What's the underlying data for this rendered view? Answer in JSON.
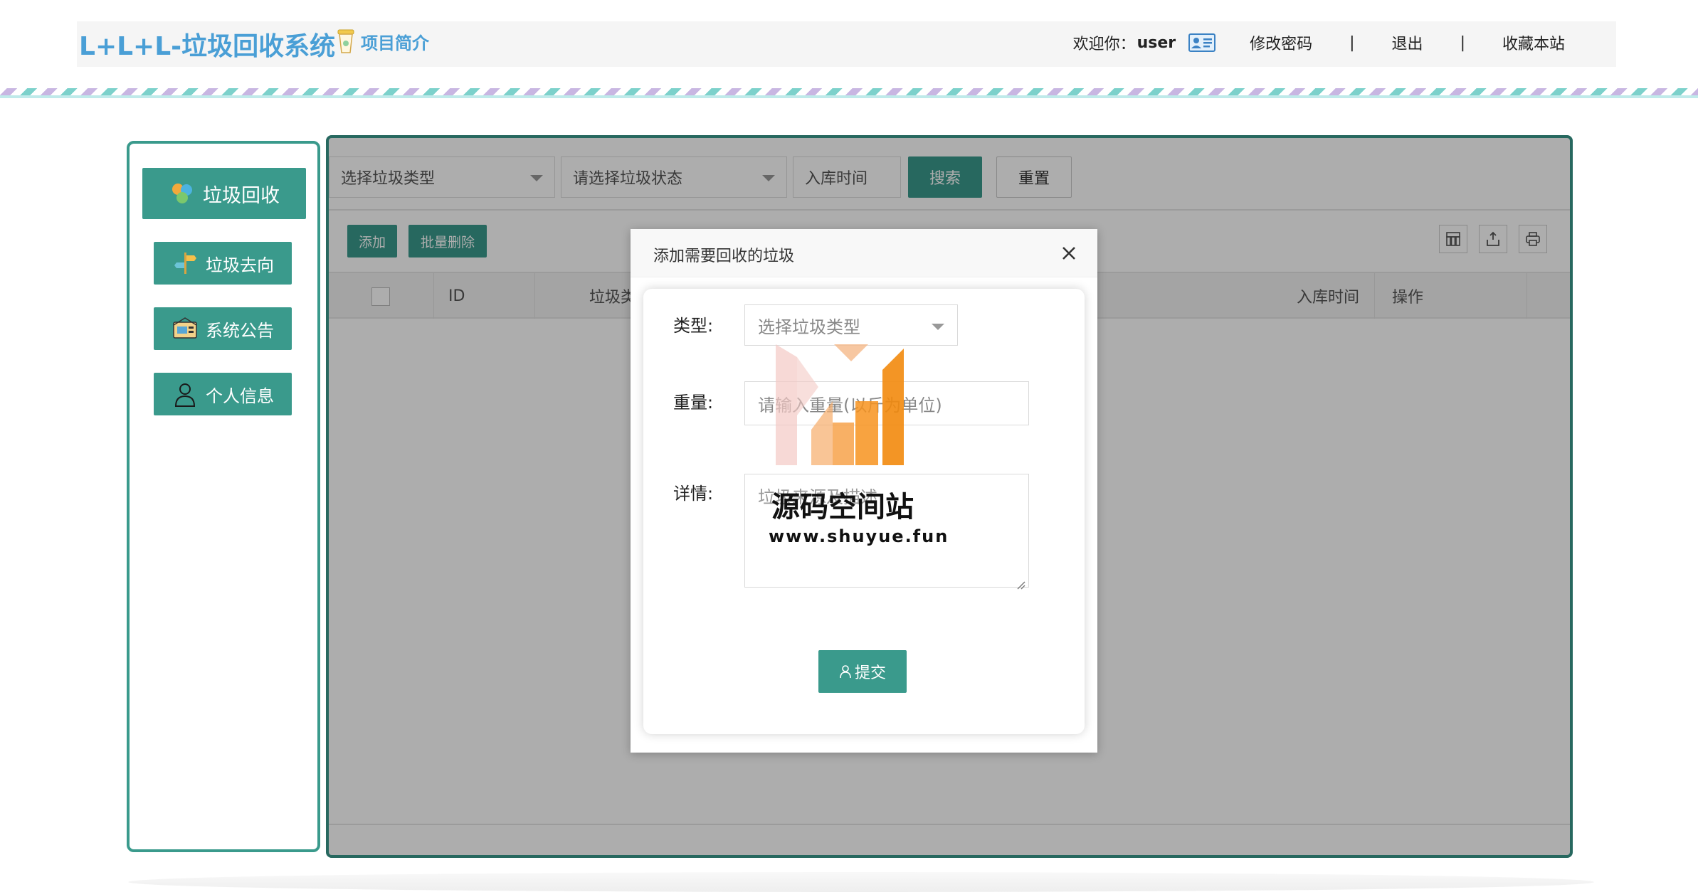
{
  "header": {
    "brand": "L+L+L-垃圾回收系统",
    "intro_label": "项目简介",
    "welcome": "欢迎你：",
    "username": "user",
    "change_password": "修改密码",
    "separator": "|",
    "logout": "退出",
    "bookmark": "收藏本站"
  },
  "sidebar": {
    "items": [
      {
        "label": "垃圾回收",
        "icon": "recycle-icon"
      },
      {
        "label": "垃圾去向",
        "icon": "signpost-icon"
      },
      {
        "label": "系统公告",
        "icon": "announcement-icon"
      },
      {
        "label": "个人信息",
        "icon": "user-icon"
      }
    ]
  },
  "filters": {
    "type_select": "选择垃圾类型",
    "status_select": "请选择垃圾状态",
    "date_input": "入库时间",
    "search_label": "搜索",
    "reset_label": "重置"
  },
  "actions": {
    "add_label": "添加",
    "batch_delete_label": "批量删除",
    "toolbar_icons": [
      "columns-icon",
      "export-icon",
      "print-icon"
    ]
  },
  "table": {
    "headers": [
      "ID",
      "垃圾类",
      "入库时间",
      "操作"
    ]
  },
  "modal": {
    "title": "添加需要回收的垃圾",
    "type_label": "类型:",
    "type_value": "选择垃圾类型",
    "weight_label": "重量:",
    "weight_placeholder": "请输入重量(以斤为单位)",
    "detail_label": "详情:",
    "detail_placeholder": "垃圾来源及描述",
    "submit_label": "提交"
  },
  "watermark": {
    "name": "源码空间站",
    "url": "www.shuyue.fun"
  },
  "colors": {
    "brand_blue": "#4a9fd6",
    "accent_green": "#3a9a8c"
  }
}
